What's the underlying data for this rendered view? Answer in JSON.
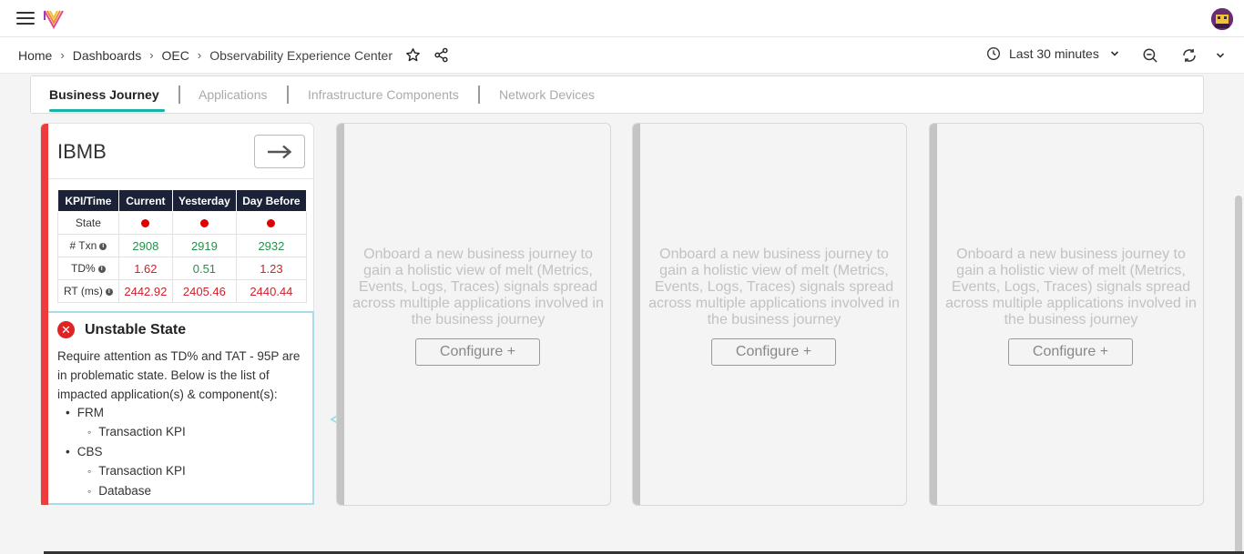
{
  "breadcrumb": {
    "items": [
      "Home",
      "Dashboards",
      "OEC",
      "Observability Experience Center"
    ]
  },
  "time_picker": {
    "label": "Last 30 minutes"
  },
  "tabs": [
    {
      "label": "Business Journey",
      "active": true
    },
    {
      "label": "Applications"
    },
    {
      "label": "Infrastructure Components"
    },
    {
      "label": "Network Devices"
    }
  ],
  "journey": {
    "title": "IBMB",
    "table": {
      "headers": [
        "KPI/Time",
        "Current",
        "Yesterday",
        "Day Before"
      ],
      "rows": [
        {
          "label": "State",
          "values": [
            "",
            "",
            ""
          ]
        },
        {
          "label": "# Txn",
          "values": [
            "2908",
            "2919",
            "2932"
          ]
        },
        {
          "label": "TD%",
          "values": [
            "1.62",
            "0.51",
            "1.23"
          ]
        },
        {
          "label": "RT (ms)",
          "values": [
            "2442.92",
            "2405.46",
            "2440.44"
          ]
        }
      ]
    },
    "status": {
      "title": "Unstable State",
      "description": "Require attention as TD% and TAT - 95P are in problematic state. Below is the list of impacted application(s) & component(s):",
      "impacted": [
        {
          "name": "FRM",
          "components": [
            "Transaction KPI"
          ]
        },
        {
          "name": "CBS",
          "components": [
            "Transaction KPI",
            "Database"
          ]
        }
      ]
    }
  },
  "onboard": {
    "text": "Onboard a new business journey to gain a holistic view of melt (Metrics, Events, Logs, Traces) signals spread across multiple applications involved in the business journey",
    "button": "Configure"
  },
  "colors": {
    "accent": "#17b3a3",
    "critical": "#ee3b3b",
    "good": "#22914a",
    "bad": "#d0202a",
    "table_header": "#1b2238"
  }
}
